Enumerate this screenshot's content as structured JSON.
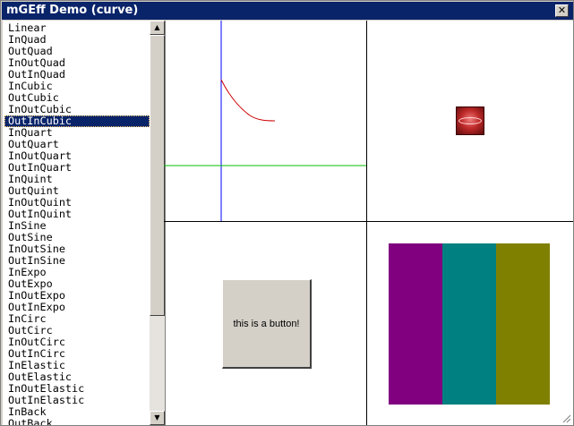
{
  "window": {
    "title": "mGEff Demo (curve)",
    "close_glyph": "✕"
  },
  "list": {
    "items": [
      "Linear",
      "InQuad",
      "OutQuad",
      "InOutQuad",
      "OutInQuad",
      "InCubic",
      "OutCubic",
      "InOutCubic",
      "OutInCubic",
      "InQuart",
      "OutQuart",
      "InOutQuart",
      "OutInQuart",
      "InQuint",
      "OutQuint",
      "InOutQuint",
      "OutInQuint",
      "InSine",
      "OutSine",
      "InOutSine",
      "OutInSine",
      "InExpo",
      "OutExpo",
      "InOutExpo",
      "OutInExpo",
      "InCirc",
      "OutCirc",
      "InOutCirc",
      "OutInCirc",
      "InElastic",
      "OutElastic",
      "InOutElastic",
      "OutInElastic",
      "InBack",
      "OutBack"
    ],
    "selected": "OutInCubic"
  },
  "scrollbar": {
    "up_icon": "scroll-up-arrow-icon",
    "down_icon": "scroll-down-arrow-icon"
  },
  "panels": {
    "demo_button_label": "this is a button!",
    "curve_colors": {
      "vertical_axis": "#0000ff",
      "horizontal_axis": "#00c000",
      "curve": "#cc0000"
    },
    "block_colors": [
      "#800080",
      "#008080",
      "#808000"
    ],
    "sprite_icon": "logo-sprite-icon"
  }
}
